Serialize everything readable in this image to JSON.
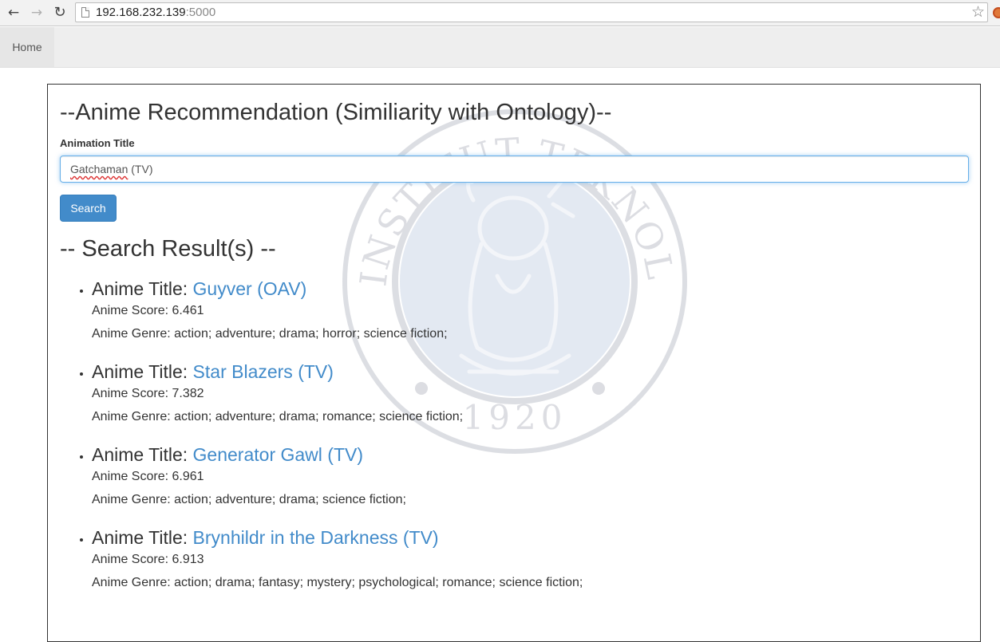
{
  "browser": {
    "url_host": "192.168.232.139",
    "url_port": ":5000"
  },
  "navbar": {
    "home_label": "Home"
  },
  "page": {
    "title": "--Anime Recommendation (Similiarity with Ontology)--",
    "field_label": "Animation Title",
    "input_value_word": "Gatchaman",
    "input_value_rest": " (TV)",
    "search_button": "Search",
    "results_heading": "-- Search Result(s) --"
  },
  "watermark": {
    "arc_text": "INSTITUT TEKNOLOGI BANDUNG",
    "year": "1920"
  },
  "results": [
    {
      "title_prefix": "Anime Title: ",
      "title": "Guyver (OAV)",
      "score_line": "Anime Score: 6.461",
      "genre_line": "Anime Genre: action; adventure; drama; horror; science fiction;"
    },
    {
      "title_prefix": "Anime Title: ",
      "title": "Star Blazers (TV)",
      "score_line": "Anime Score: 7.382",
      "genre_line": "Anime Genre: action; adventure; drama; romance; science fiction;"
    },
    {
      "title_prefix": "Anime Title: ",
      "title": "Generator Gawl (TV)",
      "score_line": "Anime Score: 6.961",
      "genre_line": "Anime Genre: action; adventure; drama; science fiction;"
    },
    {
      "title_prefix": "Anime Title: ",
      "title": "Brynhildr in the Darkness (TV)",
      "score_line": "Anime Score: 6.913",
      "genre_line": "Anime Genre: action; drama; fantasy; mystery; psychological; romance; science fiction;"
    }
  ],
  "colors": {
    "link": "#428bca",
    "button": "#428bca",
    "watermark": "#d8dfe8"
  }
}
